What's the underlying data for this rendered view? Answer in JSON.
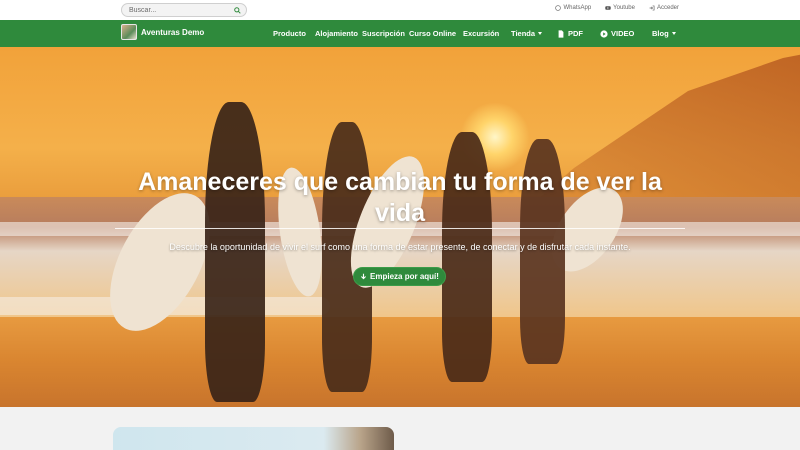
{
  "topbar": {
    "search_placeholder": "Buscar...",
    "links": [
      {
        "label": "WhatsApp",
        "icon": "whatsapp-icon"
      },
      {
        "label": "Youtube",
        "icon": "youtube-icon"
      },
      {
        "label": "Acceder",
        "icon": "login-icon"
      }
    ]
  },
  "nav": {
    "brand": "Aventuras Demo",
    "items": [
      "Producto",
      "Alojamiento",
      "Suscripción",
      "Curso Online",
      "Excursión",
      "Tienda",
      "PDF",
      "VIDEO",
      "Blog"
    ]
  },
  "hero": {
    "title": "Amaneceres que cambian tu forma de ver la vida",
    "subtitle": "Descubre  la oportunidad de vivir el surf como una forma de estar presente, de conectar y de disfrutar cada instante.",
    "cta": "Empieza por aquí!"
  },
  "colors": {
    "nav_green": "#2f8a3c",
    "white": "#ffffff"
  }
}
